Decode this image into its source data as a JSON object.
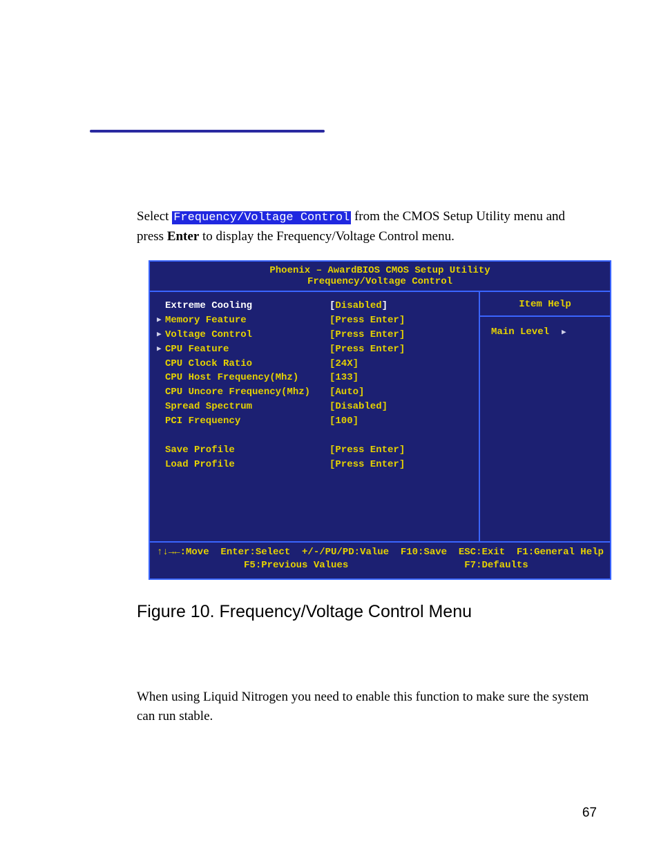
{
  "intro": {
    "select_word": "Select ",
    "code_token": "Frequency/Voltage Control",
    "after_token": " from the CMOS Setup Utility menu and press ",
    "enter_word": "Enter",
    "tail": " to display the Frequency/Voltage Control menu."
  },
  "bios": {
    "title": "Phoenix – AwardBIOS CMOS Setup Utility",
    "subtitle": "Frequency/Voltage Control",
    "items": [
      {
        "tri": false,
        "name": "Extreme Cooling",
        "val_pre": "[",
        "val_mid": "Disabled",
        "val_post": "]",
        "name_white": true,
        "val_mid_yellow": true
      },
      {
        "tri": true,
        "name": "Memory Feature",
        "val_pre": "",
        "val_mid": "[Press Enter]",
        "val_post": "",
        "name_white": false,
        "val_mid_yellow": true
      },
      {
        "tri": true,
        "name": "Voltage Control",
        "val_pre": "",
        "val_mid": "[Press Enter]",
        "val_post": "",
        "name_white": false,
        "val_mid_yellow": true
      },
      {
        "tri": true,
        "name": "CPU Feature",
        "val_pre": "",
        "val_mid": "[Press Enter]",
        "val_post": "",
        "name_white": false,
        "val_mid_yellow": true
      },
      {
        "tri": false,
        "name": "CPU Clock Ratio",
        "val_pre": "",
        "val_mid": "[24X]",
        "val_post": "",
        "name_white": false,
        "val_mid_yellow": true
      },
      {
        "tri": false,
        "name": "CPU Host Frequency(Mhz)",
        "val_pre": "",
        "val_mid": "[133]",
        "val_post": "",
        "name_white": false,
        "val_mid_yellow": true
      },
      {
        "tri": false,
        "name": "CPU Uncore Frequency(Mhz)",
        "val_pre": "",
        "val_mid": "[Auto]",
        "val_post": "",
        "name_white": false,
        "val_mid_yellow": true
      },
      {
        "tri": false,
        "name": "Spread Spectrum",
        "val_pre": "",
        "val_mid": "[Disabled]",
        "val_post": "",
        "name_white": false,
        "val_mid_yellow": true
      },
      {
        "tri": false,
        "name": "PCI Frequency",
        "val_pre": "",
        "val_mid": "[100]",
        "val_post": "",
        "name_white": false,
        "val_mid_yellow": true
      },
      {
        "spacer": true
      },
      {
        "tri": false,
        "name": "Save Profile",
        "val_pre": "",
        "val_mid": "[Press Enter]",
        "val_post": "",
        "name_white": false,
        "val_mid_yellow": true
      },
      {
        "tri": false,
        "name": "Load Profile",
        "val_pre": "",
        "val_mid": "[Press Enter]",
        "val_post": "",
        "name_white": false,
        "val_mid_yellow": true
      }
    ],
    "help_title": "Item Help",
    "main_level": "Main Level",
    "footer_line1": "↑↓→←:Move  Enter:Select  +/-/PU/PD:Value  F10:Save  ESC:Exit  F1:General Help",
    "footer_line2": "               F5:Previous Values                    F7:Defaults"
  },
  "figure_caption": "Figure 10.    Frequency/Voltage Control Menu",
  "second_para": "When using Liquid Nitrogen you need to enable this function to make sure the system can run stable.",
  "page_number": "67"
}
